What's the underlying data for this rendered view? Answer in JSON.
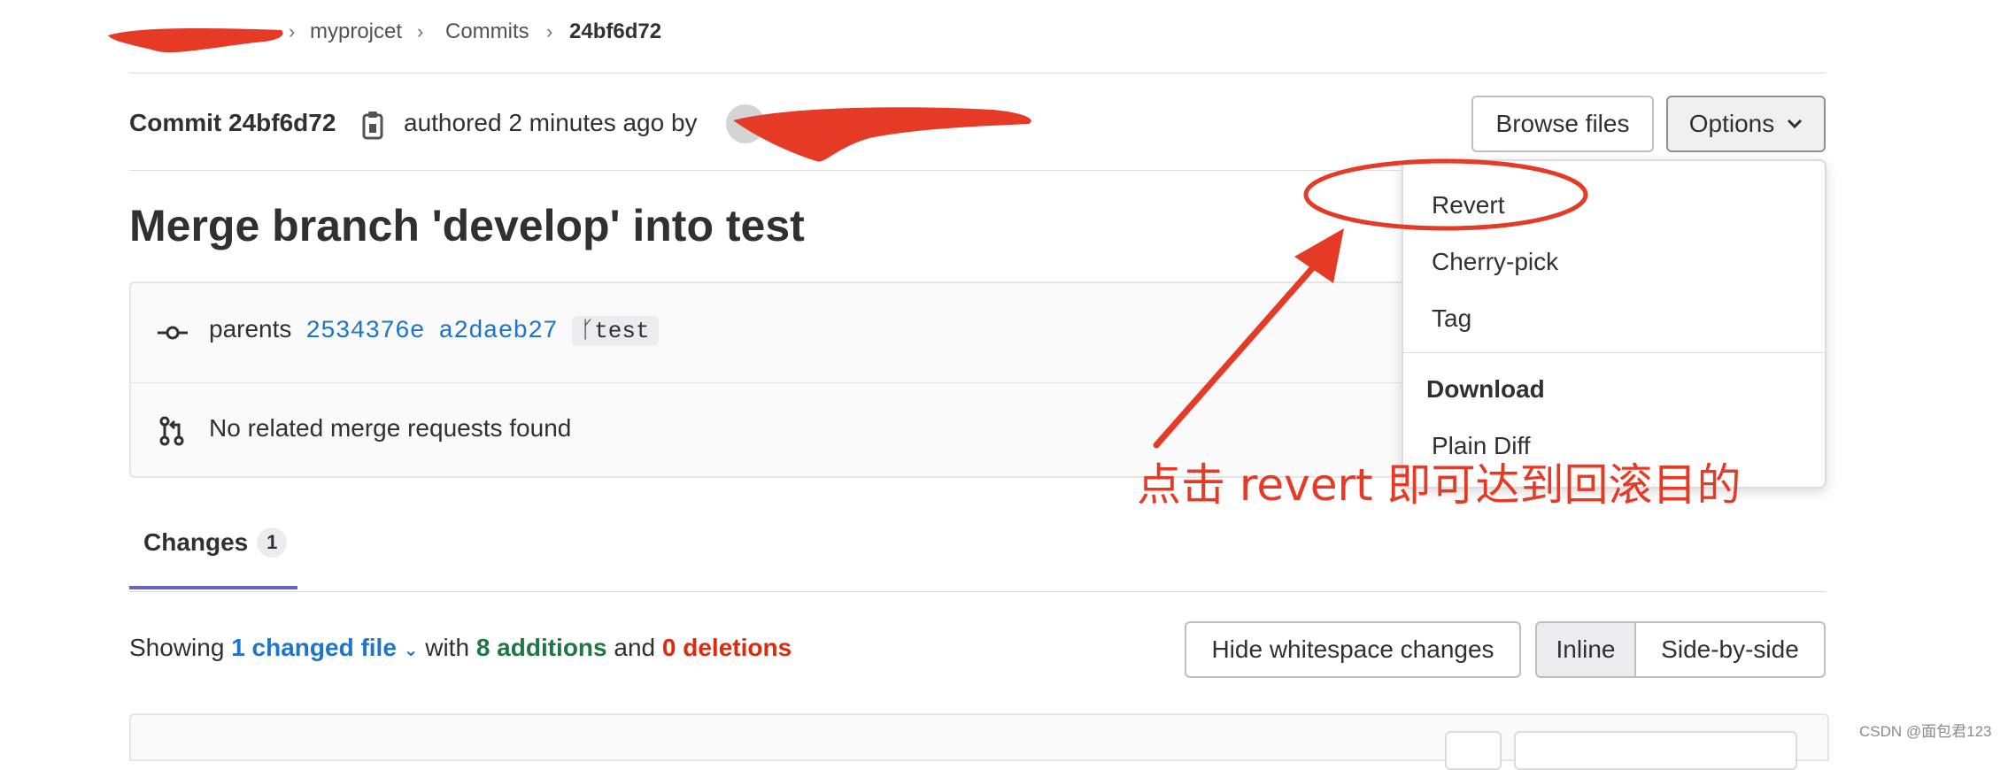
{
  "breadcrumb": {
    "items": [
      "myprojcet",
      "Commits"
    ],
    "current": "24bf6d72"
  },
  "commit": {
    "label": "Commit 24bf6d72",
    "authored": "authored 2 minutes ago by"
  },
  "header_buttons": {
    "browse_files": "Browse files",
    "options": "Options"
  },
  "title": "Merge branch 'develop' into test",
  "info": {
    "parents_label": "parents",
    "parent_1": "2534376e",
    "parent_2": "a2daeb27",
    "branch": "test",
    "merge_requests": "No related merge requests found"
  },
  "tabs": {
    "changes_label": "Changes",
    "changes_count": "1"
  },
  "dropdown": {
    "items": [
      "Revert",
      "Cherry-pick",
      "Tag"
    ],
    "download_header": "Download",
    "download_items": [
      "Plain Diff"
    ]
  },
  "toolbar": {
    "showing": "Showing",
    "changed_files": "1 changed file",
    "with": "with",
    "additions": "8 additions",
    "and": "and",
    "deletions": "0 deletions",
    "hide_whitespace": "Hide whitespace changes",
    "inline": "Inline",
    "side_by_side": "Side-by-side"
  },
  "annotation": "点击 revert 即可达到回滚目的",
  "watermark": "CSDN @面包君123",
  "colors": {
    "link": "#1f75cb",
    "additions": "#217645",
    "deletions": "#dd2b0e",
    "annotation": "#e53a25",
    "active_tab": "#6666c4"
  }
}
